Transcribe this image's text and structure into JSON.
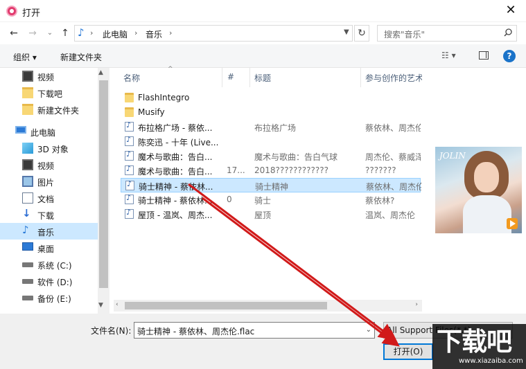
{
  "window": {
    "title": "打开",
    "close": "✕"
  },
  "nav": {
    "back": "←",
    "forward": "→",
    "recent": "⌄",
    "up": "↑",
    "breadcrumb": [
      "此电脑",
      "音乐"
    ],
    "search_placeholder": "搜索\"音乐\"",
    "refresh": "↻"
  },
  "toolbar": {
    "organize": "组织 ▾",
    "new_folder": "新建文件夹",
    "view": "☷ ▾",
    "help": "?"
  },
  "sidebar": {
    "items": [
      {
        "label": "视频",
        "icon": "video-icon"
      },
      {
        "label": "下载吧",
        "icon": "folder-icon"
      },
      {
        "label": "新建文件夹",
        "icon": "folder-icon"
      },
      {
        "label": "此电脑",
        "icon": "computer-icon"
      },
      {
        "label": "3D 对象",
        "icon": "3d-objects-icon"
      },
      {
        "label": "视频",
        "icon": "video-icon"
      },
      {
        "label": "图片",
        "icon": "pictures-icon"
      },
      {
        "label": "文档",
        "icon": "documents-icon"
      },
      {
        "label": "下载",
        "icon": "download-icon"
      },
      {
        "label": "音乐",
        "icon": "music-icon",
        "selected": true
      },
      {
        "label": "桌面",
        "icon": "desktop-icon"
      },
      {
        "label": "系统 (C:)",
        "icon": "drive-icon"
      },
      {
        "label": "软件 (D:)",
        "icon": "drive-icon"
      },
      {
        "label": "备份 (E:)",
        "icon": "drive-icon"
      }
    ]
  },
  "columns": {
    "name": "名称",
    "num": "#",
    "title": "标题",
    "artist": "参与创作的艺术"
  },
  "files": [
    {
      "type": "folder",
      "name": "FlashIntegro",
      "num": "",
      "title": "",
      "artist": ""
    },
    {
      "type": "folder",
      "name": "Musify",
      "num": "",
      "title": "",
      "artist": ""
    },
    {
      "type": "music",
      "name": "布拉格广场 - 蔡依...",
      "num": "",
      "title": "布拉格广场",
      "artist": "蔡依林、周杰伦"
    },
    {
      "type": "music",
      "name": "陈奕迅 - 十年 (Live...",
      "num": "",
      "title": "",
      "artist": ""
    },
    {
      "type": "music",
      "name": "魔术与歌曲：告白...",
      "num": "",
      "title": "魔术与歌曲：告白气球",
      "artist": "周杰伦、蔡威泽"
    },
    {
      "type": "music",
      "name": "魔术与歌曲：告白...",
      "num": "17...",
      "title": "2018????????????",
      "artist": "???????"
    },
    {
      "type": "music",
      "name": "骑士精神 - 蔡依林...",
      "num": "",
      "title": "骑士精神",
      "artist": "蔡依林、周杰伦",
      "selected": true
    },
    {
      "type": "music",
      "name": "骑士精神 - 蔡依林...",
      "num": "0",
      "title": "骑士",
      "artist": "蔡依林?"
    },
    {
      "type": "music",
      "name": "屋顶 - 温岚、周杰...",
      "num": "",
      "title": "屋顶",
      "artist": "温岚、周杰伦"
    }
  ],
  "preview": {
    "logo_text": "JOLIN"
  },
  "bottom": {
    "filename_label": "文件名(N):",
    "filename_value": "骑士精神 - 蔡依林、周杰伦.flac",
    "filter_value": "All Support Files(*.*)",
    "open_label": "打开(O)"
  },
  "watermark": {
    "main": "下载吧",
    "sub": "www.xiazaiba.com"
  },
  "colors": {
    "selection": "#cce8ff",
    "accent": "#0078d7",
    "arrow": "#d11a1a"
  }
}
